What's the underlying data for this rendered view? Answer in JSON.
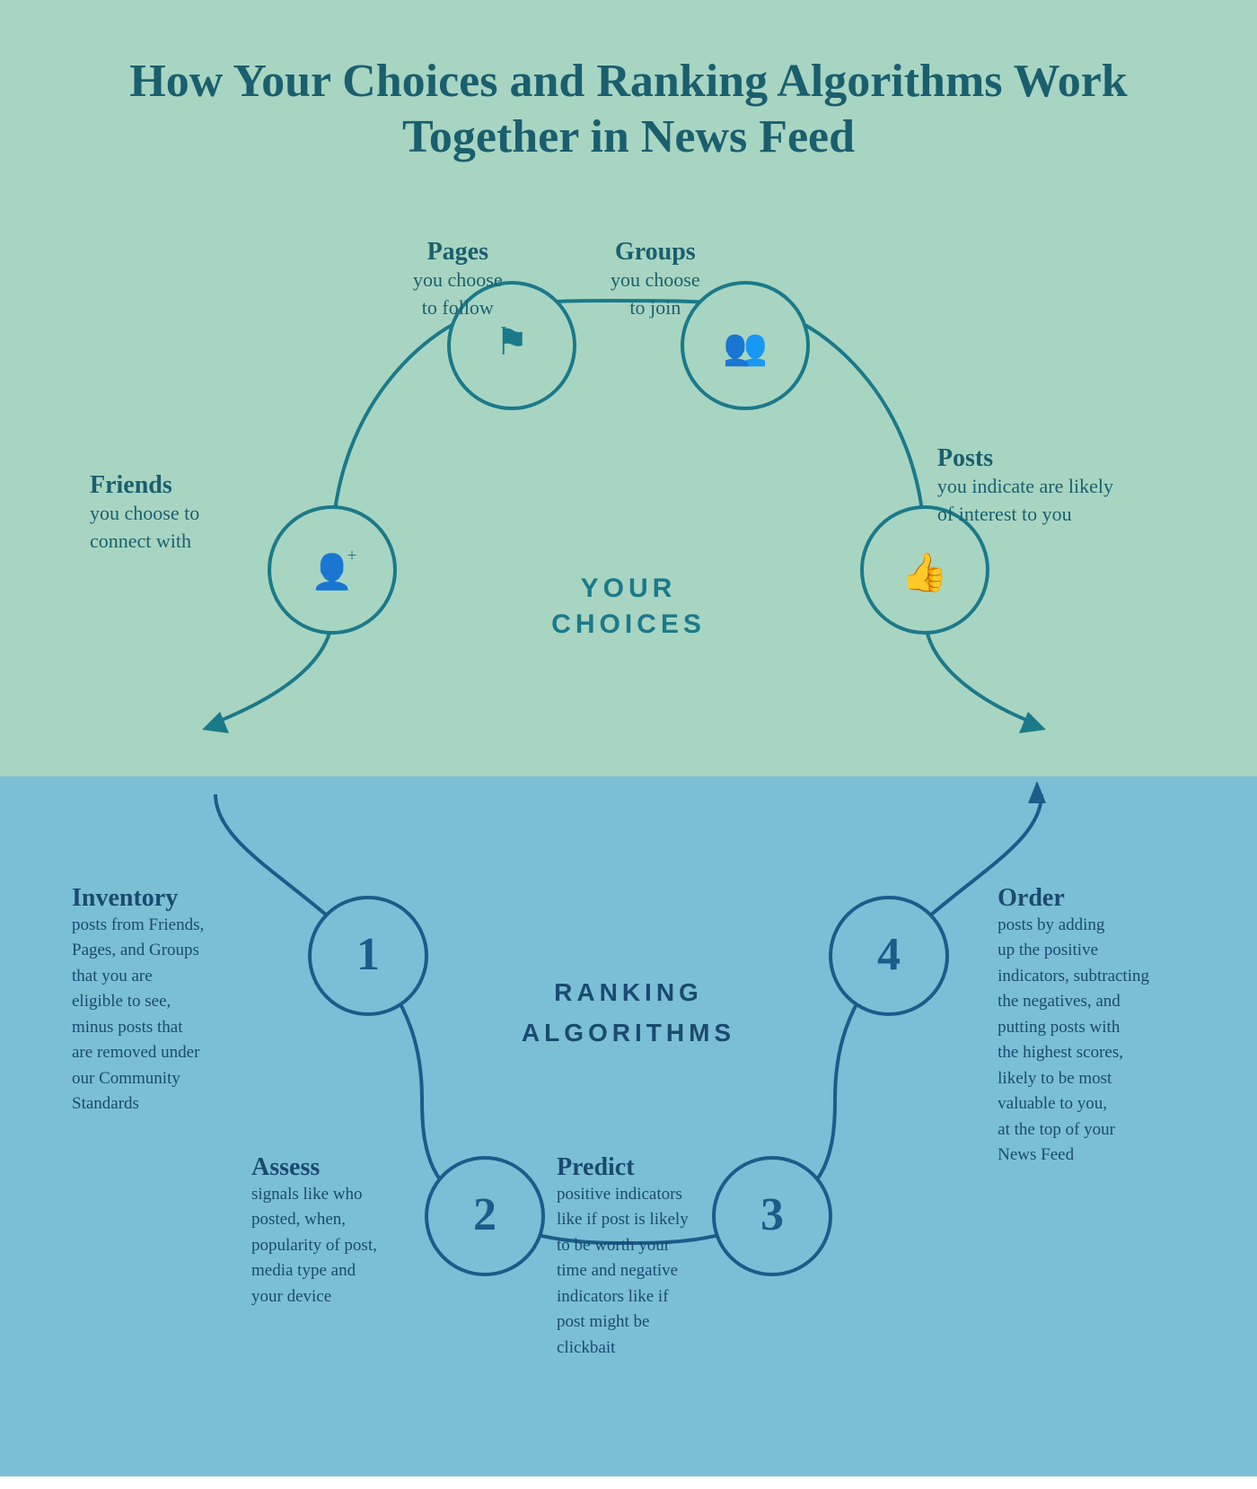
{
  "title": "How Your Choices and Ranking Algorithms Work Together in News Feed",
  "top_section": {
    "bg_color": "#a8d5c2",
    "labels": {
      "pages": {
        "bold": "Pages",
        "regular": "you choose\nto follow"
      },
      "groups": {
        "bold": "Groups",
        "regular": "you choose\nto join"
      },
      "friends": {
        "bold": "Friends",
        "regular": "you choose to\nconnect with"
      },
      "posts": {
        "bold": "Posts",
        "regular": "you indicate are likely\nof interest to you"
      },
      "your_choices": "YOUR\nCHOICES"
    }
  },
  "bottom_section": {
    "bg_color": "#7bbfd6",
    "labels": {
      "ranking_algorithms": "RANKING\nALGORITHMS",
      "inventory": {
        "bold": "Inventory",
        "regular": "posts from Friends,\nPages, and Groups\nthat you are\neligible to see,\nminus posts that\nare removed under\nour Community\nStandards"
      },
      "assess": {
        "bold": "Assess",
        "regular": "signals like who\nposted, when,\npopularity of post,\nmedia type and\nyour device"
      },
      "predict": {
        "bold": "Predict",
        "regular": "positive indicators\nlike if post is likely\nto be worth your\ntime and negative\nindicators like if\npost might be\nclickbait"
      },
      "order": {
        "bold": "Order",
        "regular": "posts by adding\nup the positive\nindicators, subtracting\nthe negatives, and\nputting posts with\nthe highest scores,\nlikely to be most\nvaluable to you,\nat the top of your\nNews Feed"
      }
    },
    "numbers": [
      "1",
      "2",
      "3",
      "4"
    ]
  },
  "colors": {
    "top_bg": "#a8d5c2",
    "bottom_bg": "#7bbfd6",
    "teal_dark": "#1a5f6e",
    "blue_dark": "#1a4a70",
    "circle_stroke": "#1a7a8a",
    "circle_fill_top": "#a8d5c2",
    "circle_fill_bottom": "#7bbfd6"
  }
}
